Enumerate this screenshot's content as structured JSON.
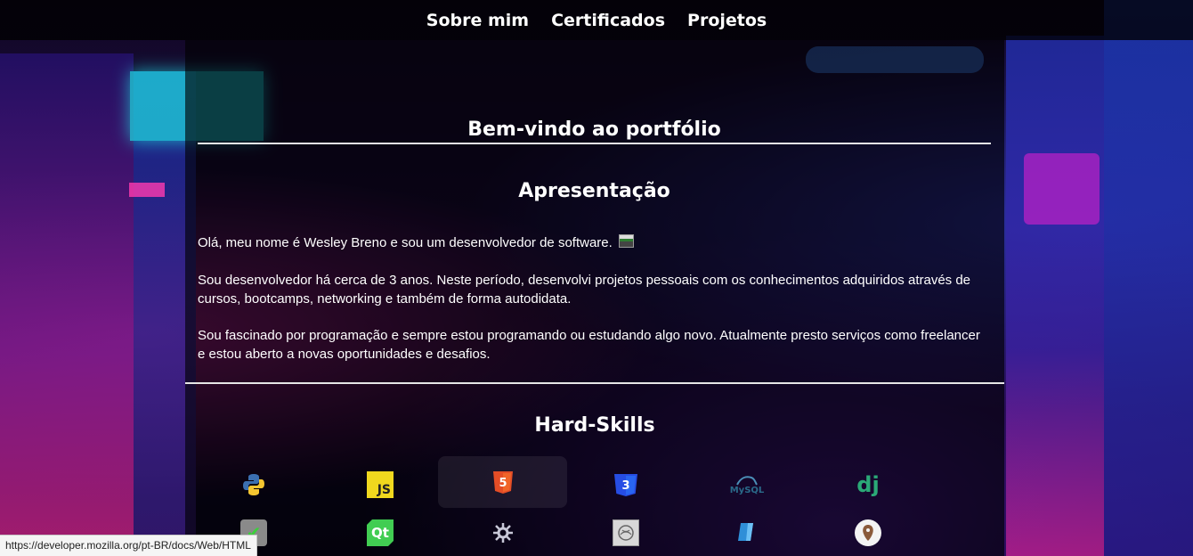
{
  "nav": {
    "items": [
      {
        "label": "Sobre mim"
      },
      {
        "label": "Certificados"
      },
      {
        "label": "Projetos"
      }
    ]
  },
  "welcome": {
    "title": "Bem-vindo ao portfólio"
  },
  "about": {
    "title": "Apresentação",
    "paragraphs": [
      "Olá, meu nome é Wesley Breno e sou um desenvolvedor de software.",
      "Sou desenvolvedor há cerca de 3 anos. Neste período, desenvolvi projetos pessoais com os conhecimentos adquiridos através de cursos, bootcamps, networking e também de forma autodidata.",
      "Sou fascinado por programação e sempre estou programando ou estudando algo novo. Atualmente presto serviços como freelancer e estou aberto a novas oportunidades e desafios."
    ]
  },
  "skills": {
    "title": "Hard-Skills",
    "icons": [
      {
        "name": "python-icon",
        "text": "",
        "color": "#3b6fb0"
      },
      {
        "name": "javascript-icon",
        "text": "JS",
        "color": "#f0d81e"
      },
      {
        "name": "html5-icon",
        "text": "5",
        "color": "#e44d26"
      },
      {
        "name": "css3-icon",
        "text": "3",
        "color": "#264de4"
      },
      {
        "name": "mysql-icon",
        "text": "MySQL",
        "color": "#2a6a8a"
      },
      {
        "name": "django-icon",
        "text": "dj",
        "color": "#2ba977"
      },
      {
        "name": "testing-icon",
        "text": "✔",
        "color": "#888888"
      },
      {
        "name": "qt-icon",
        "text": "Qt",
        "color": "#41cd52"
      },
      {
        "name": "gear-icon",
        "text": "",
        "color": "#c8c8d8"
      },
      {
        "name": "library-icon",
        "text": "",
        "color": "#bbbbbb"
      },
      {
        "name": "sqlite-icon",
        "text": "",
        "color": "#2f8fd8"
      },
      {
        "name": "git-icon",
        "text": "",
        "color": "#8a5a3a"
      }
    ]
  },
  "status_bar": {
    "url": "https://developer.mozilla.org/pt-BR/docs/Web/HTML"
  }
}
